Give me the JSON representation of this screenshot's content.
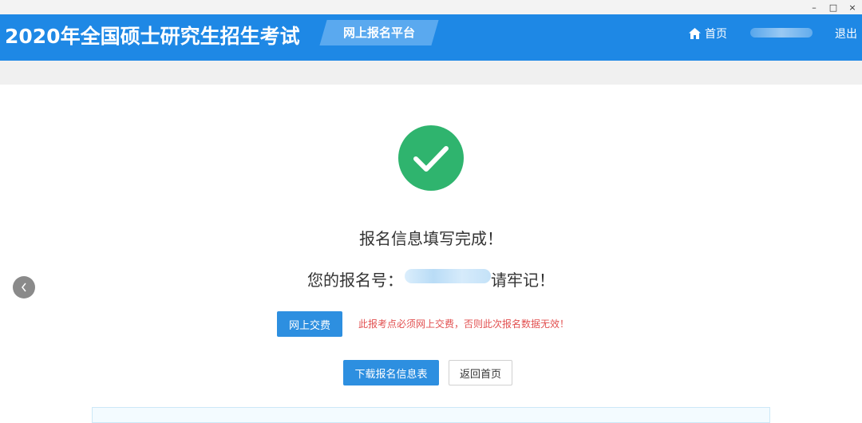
{
  "window": {
    "minimize": "–",
    "maximize": "□",
    "close": "×"
  },
  "header": {
    "title": "2020年全国硕士研究生招生考试",
    "platform": "网上报名平台",
    "home_label": "首页",
    "logout_label": "退出"
  },
  "result": {
    "complete_text": "报名信息填写完成！",
    "number_prefix": "您的报名号：",
    "number_suffix": "请牢记！"
  },
  "actions": {
    "pay_button": "网上交费",
    "pay_warning": "此报考点必须网上交费，否则此次报名数据无效！",
    "download_button": "下载报名信息表",
    "back_button": "返回首页"
  },
  "colors": {
    "header": "#1e88e5",
    "success": "#2fb46e",
    "primary_button": "#2d8fe0",
    "warning_text": "#e25050"
  }
}
